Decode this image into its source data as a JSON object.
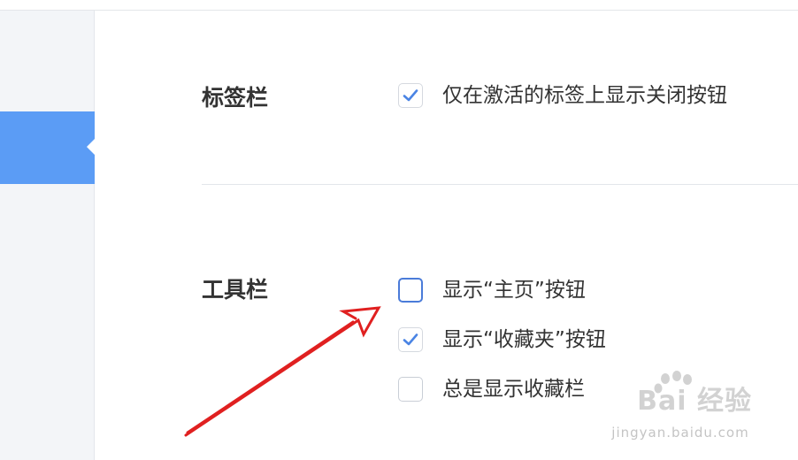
{
  "sections": {
    "tabbar": {
      "label": "标签栏",
      "options": [
        {
          "label": "仅在激活的标签上显示关闭按钮",
          "checked": true
        }
      ]
    },
    "toolbar": {
      "label": "工具栏",
      "options": [
        {
          "label": "显示“主页”按钮",
          "checked": false,
          "focused": true
        },
        {
          "label": "显示“收藏夹”按钮",
          "checked": true
        },
        {
          "label": "总是显示收藏栏",
          "checked": false
        }
      ]
    }
  },
  "watermark": {
    "brand": "Bai 经验",
    "url": "jingyan.baidu.com"
  },
  "colors": {
    "accent": "#5b9cf5",
    "check": "#4a84e4",
    "annotation": "#e02020"
  },
  "icons": {
    "check": "checkmark-icon",
    "annotation": "red-arrow-icon"
  }
}
